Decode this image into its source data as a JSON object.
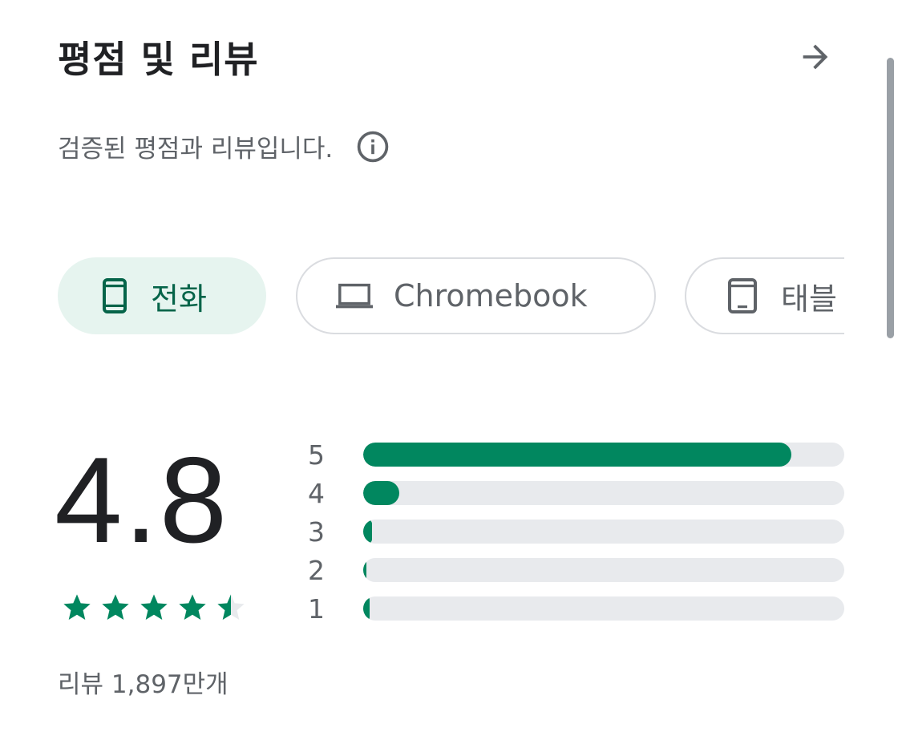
{
  "header": {
    "title": "평점 및 리뷰",
    "arrow_icon": "arrow-right-icon"
  },
  "subtitle": {
    "text": "검증된 평점과 리뷰입니다.",
    "info_icon": "info-icon"
  },
  "device_chips": [
    {
      "label": "전화",
      "icon": "phone-icon",
      "selected": true
    },
    {
      "label": "Chromebook",
      "icon": "laptop-icon",
      "selected": false
    },
    {
      "label": "태블",
      "icon": "tablet-icon",
      "selected": false
    }
  ],
  "rating": {
    "score": "4.8",
    "stars_filled": 4.5,
    "stars_total": 5,
    "review_count_text": "리뷰 1,897만개"
  },
  "distribution": [
    {
      "label": "5",
      "fraction": 0.89
    },
    {
      "label": "4",
      "fraction": 0.075
    },
    {
      "label": "3",
      "fraction": 0.018
    },
    {
      "label": "2",
      "fraction": 0.005
    },
    {
      "label": "1",
      "fraction": 0.013
    }
  ],
  "colors": {
    "accent": "#01875f",
    "chip_selected_bg": "#e6f4ef",
    "track": "#e8eaed",
    "text_primary": "#202124",
    "text_secondary": "#5f6368"
  }
}
